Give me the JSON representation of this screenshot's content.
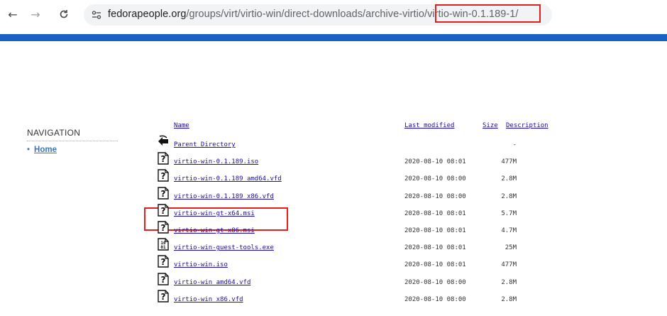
{
  "browser": {
    "url_host": "fedorapeople.org",
    "url_path": "/groups/virt/virtio-win/direct-downloads/archive-virtio/virtio-win-0.1.189-1/"
  },
  "sidebar": {
    "heading": "NAVIGATION",
    "items": [
      {
        "label": "Home"
      }
    ]
  },
  "table": {
    "headers": {
      "name": "Name",
      "last_modified": "Last modified",
      "size": "Size",
      "description": "Description"
    },
    "rows": [
      {
        "icon": "back-arrow-icon",
        "name": "Parent Directory",
        "date": "",
        "size": "-"
      },
      {
        "icon": "unknown-file-icon",
        "name": "virtio-win-0.1.189.iso",
        "date": "2020-08-10 08:01",
        "size": "477M"
      },
      {
        "icon": "unknown-file-icon",
        "name": "virtio-win-0.1.189_amd64.vfd",
        "date": "2020-08-10 08:00",
        "size": "2.8M"
      },
      {
        "icon": "unknown-file-icon",
        "name": "virtio-win-0.1.189_x86.vfd",
        "date": "2020-08-10 08:00",
        "size": "2.8M"
      },
      {
        "icon": "unknown-file-icon",
        "name": "virtio-win-gt-x64.msi",
        "date": "2020-08-10 08:01",
        "size": "5.7M"
      },
      {
        "icon": "unknown-file-icon",
        "name": "virtio-win-gt-x86.msi",
        "date": "2020-08-10 08:01",
        "size": "4.7M"
      },
      {
        "icon": "binary-file-icon",
        "name": "virtio-win-guest-tools.exe",
        "date": "2020-08-10 08:01",
        "size": "25M"
      },
      {
        "icon": "unknown-file-icon",
        "name": "virtio-win.iso",
        "date": "2020-08-10 08:01",
        "size": "477M"
      },
      {
        "icon": "unknown-file-icon",
        "name": "virtio-win_amd64.vfd",
        "date": "2020-08-10 08:00",
        "size": "2.8M"
      },
      {
        "icon": "unknown-file-icon",
        "name": "virtio-win_x86.vfd",
        "date": "2020-08-10 08:00",
        "size": "2.8M"
      }
    ]
  },
  "colors": {
    "accent_bar": "#1762c4",
    "highlight": "#e0201e",
    "link": "#1a0dab"
  }
}
